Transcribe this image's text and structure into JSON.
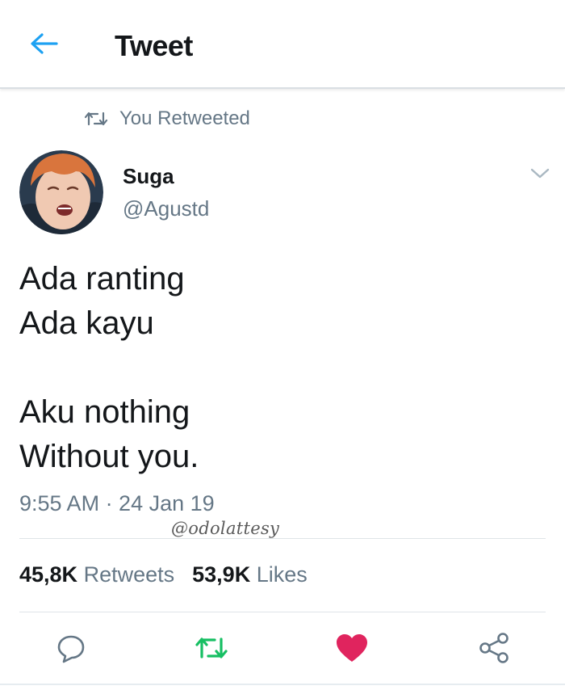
{
  "header": {
    "title": "Tweet",
    "back_icon": "arrow-left-icon"
  },
  "retweet_context": {
    "text": "You Retweeted",
    "icon": "retweet-icon"
  },
  "author": {
    "name": "Suga",
    "handle": "@Agustd",
    "avatar": "profile-photo"
  },
  "tweet": {
    "lines": [
      "Ada ranting",
      "Ada kayu",
      "",
      "Aku nothing",
      "Without you."
    ],
    "timestamp": "9:55 AM · 24 Jan 19"
  },
  "watermark": "@odolattesy",
  "stats": {
    "retweets_count": "45,8K",
    "retweets_label": "Retweets",
    "likes_count": "53,9K",
    "likes_label": "Likes"
  },
  "actions": {
    "reply": "reply-icon",
    "retweet": "retweet-icon",
    "like": "heart-icon",
    "share": "share-icon"
  },
  "colors": {
    "accent": "#1da1f2",
    "retweet_green": "#17bf63",
    "like_red": "#e0245e",
    "secondary_text": "#657786"
  }
}
